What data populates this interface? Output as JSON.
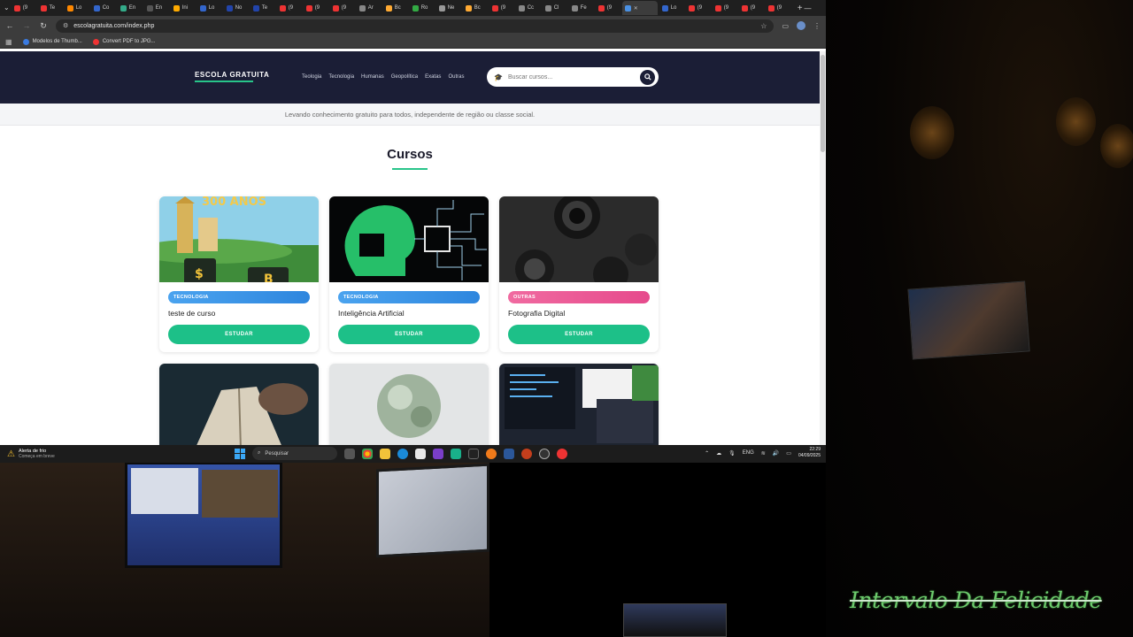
{
  "browser": {
    "tabs": [
      {
        "label": "(9",
        "color": "#e33"
      },
      {
        "label": "Te",
        "color": "#e33"
      },
      {
        "label": "Lo",
        "color": "#f80"
      },
      {
        "label": "Co",
        "color": "#36c"
      },
      {
        "label": "En",
        "color": "#3a8"
      },
      {
        "label": "En",
        "color": "#555"
      },
      {
        "label": "Ini",
        "color": "#fa0"
      },
      {
        "label": "Lo",
        "color": "#36c"
      },
      {
        "label": "No",
        "color": "#24a"
      },
      {
        "label": "Te",
        "color": "#24a"
      },
      {
        "label": "(9",
        "color": "#e33"
      },
      {
        "label": "(9",
        "color": "#e33"
      },
      {
        "label": "(9",
        "color": "#e33"
      },
      {
        "label": "Ar",
        "color": "#888"
      },
      {
        "label": "Bc",
        "color": "#fa3"
      },
      {
        "label": "Ro",
        "color": "#3a4"
      },
      {
        "label": "Ne",
        "color": "#999"
      },
      {
        "label": "Bc",
        "color": "#fa3"
      },
      {
        "label": "(9",
        "color": "#e33"
      },
      {
        "label": "Cc",
        "color": "#888"
      },
      {
        "label": "Cl",
        "color": "#888"
      },
      {
        "label": "Fe",
        "color": "#888"
      },
      {
        "label": "(9",
        "color": "#e33"
      }
    ],
    "after_tabs": [
      {
        "label": "Lo",
        "color": "#36c"
      },
      {
        "label": "(9",
        "color": "#e33"
      },
      {
        "label": "(9",
        "color": "#e33"
      },
      {
        "label": "(9",
        "color": "#e33"
      },
      {
        "label": "(9",
        "color": "#e33"
      }
    ],
    "url": "escolagratuita.com/index.php",
    "bookmarks": [
      {
        "label": "Modelos de Thumb...",
        "color": "#3b7be0"
      },
      {
        "label": "Convert PDF to JPG...",
        "color": "#e33"
      }
    ]
  },
  "site": {
    "logo": "ESCOLA GRATUITA",
    "menu": [
      "Teologia",
      "Tecnologia",
      "Humanas",
      "Geopolítica",
      "Exatas",
      "Outras"
    ],
    "search_placeholder": "Buscar cursos...",
    "tagline": "Levando conhecimento gratuito para todos, independente de região ou classe social.",
    "section_title": "Cursos",
    "study_label": "ESTUDAR",
    "courses": [
      {
        "category": "TECNOLOGIA",
        "title": "teste de curso",
        "image_text": "300 ANOS"
      },
      {
        "category": "TECNOLOGIA",
        "title": "Inteligência Artificial"
      },
      {
        "category": "OUTRAS",
        "title": "Fotografia Digital"
      }
    ]
  },
  "taskbar": {
    "weather_title": "Alerta de frio",
    "weather_sub": "Começa em breve",
    "search_label": "Pesquisar",
    "lang": "ENG",
    "time": "22:29",
    "date": "04/09/2025"
  },
  "overlay": {
    "show_title": "Intervalo Da Felicidade"
  },
  "colors": {
    "accent_green": "#1dc088",
    "nav_bg": "#1b1e36",
    "badge_tech": "#2e86de",
    "badge_other": "#e64a8c"
  }
}
